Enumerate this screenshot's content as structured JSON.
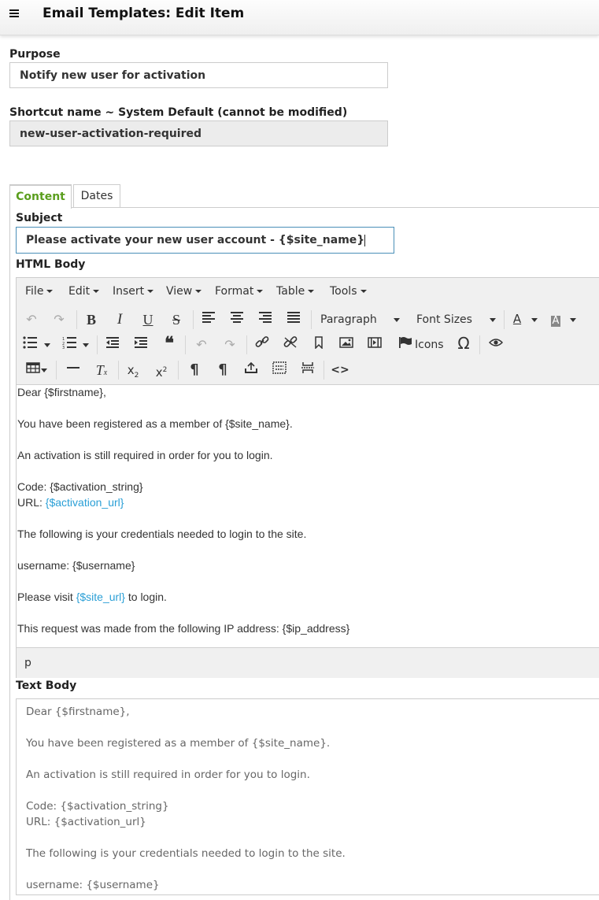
{
  "header": {
    "title": "Email Templates: Edit Item"
  },
  "form": {
    "purpose_label": "Purpose",
    "purpose_value": "Notify new user for activation",
    "shortcut_label": "Shortcut name ~ System Default (cannot be modified)",
    "shortcut_value": "new-user-activation-required"
  },
  "tabs": [
    {
      "label": "Content",
      "active": true
    },
    {
      "label": "Dates",
      "active": false
    }
  ],
  "subject": {
    "label": "Subject",
    "value": "Please activate your new user account - {$site_name}"
  },
  "html_body": {
    "label": "HTML Body",
    "menu": [
      "File",
      "Edit",
      "Insert",
      "View",
      "Format",
      "Table",
      "Tools"
    ],
    "block_format": "Paragraph",
    "font_sizes": "Font Sizes",
    "icons_label": "Icons",
    "status_path": "p",
    "lines": {
      "l1": "Dear {$firstname},",
      "l2": "You have been registered as a member of {$site_name}.",
      "l3": "An activation is still required in order for you to login.",
      "l4": "Code: {$activation_string}",
      "l5a": "URL: ",
      "l5b": "{$activation_url}",
      "l6": "The following is your credentials needed to login to the site.",
      "l7": "username: {$username}",
      "l8a": "Please visit ",
      "l8b": "{$site_url}",
      "l8c": " to login.",
      "l9": "This request was made from the following IP address: {$ip_address}"
    }
  },
  "text_body": {
    "label": "Text Body",
    "lines": {
      "l1": "Dear {$firstname},",
      "l2": "You have been registered as a member of {$site_name}.",
      "l3": "An activation is still required in order for you to login.",
      "l4": "Code: {$activation_string}",
      "l5": "URL: {$activation_url}",
      "l6": "The following is your credentials needed to login to the site.",
      "l7": "username: {$username}"
    }
  },
  "colors": {
    "accent_green": "#5a9e1d",
    "link_blue": "#2a9fd6"
  }
}
